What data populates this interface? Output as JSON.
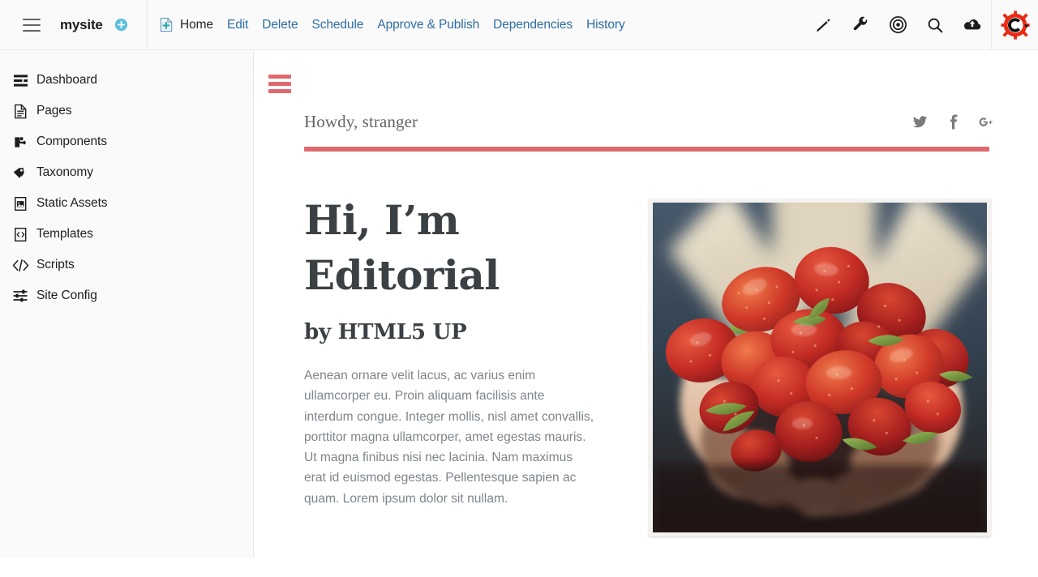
{
  "topbar": {
    "menu_icon": "hamburger-icon",
    "site_name": "mysite",
    "add_site_icon": "circle-plus-icon",
    "page_icon": "page-add-icon",
    "nav_items": [
      {
        "label": "Home",
        "active": true
      },
      {
        "label": "Edit",
        "active": false
      },
      {
        "label": "Delete",
        "active": false
      },
      {
        "label": "Schedule",
        "active": false
      },
      {
        "label": "Approve & Publish",
        "active": false
      },
      {
        "label": "Dependencies",
        "active": false
      },
      {
        "label": "History",
        "active": false
      }
    ],
    "tools": [
      {
        "name": "pencil-icon",
        "title": "Edit"
      },
      {
        "name": "wrench-icon",
        "title": "Tools"
      },
      {
        "name": "target-icon",
        "title": "Preview"
      },
      {
        "name": "search-icon",
        "title": "Search"
      },
      {
        "name": "cloud-upload-icon",
        "title": "Publish"
      }
    ],
    "logo": {
      "name": "crafter-gear-logo",
      "letter": "C"
    }
  },
  "sidebar": {
    "items": [
      {
        "label": "Dashboard",
        "icon": "dashboard-icon"
      },
      {
        "label": "Pages",
        "icon": "page-icon"
      },
      {
        "label": "Components",
        "icon": "components-icon"
      },
      {
        "label": "Taxonomy",
        "icon": "tag-icon"
      },
      {
        "label": "Static Assets",
        "icon": "image-icon"
      },
      {
        "label": "Templates",
        "icon": "template-code-icon"
      },
      {
        "label": "Scripts",
        "icon": "code-brackets-icon"
      },
      {
        "label": "Site Config",
        "icon": "sliders-icon"
      }
    ]
  },
  "preview": {
    "menu_icon": "hamburger-icon",
    "greeting": "Howdy, stranger",
    "social": [
      {
        "name": "twitter-icon",
        "label": "Twitter"
      },
      {
        "name": "facebook-icon",
        "label": "Facebook"
      },
      {
        "name": "google-plus-icon",
        "label": "Google+"
      }
    ],
    "title_line1": "Hi, I’m",
    "title_line2": "Editorial",
    "subtitle": "by HTML5 UP",
    "paragraph": "Aenean ornare velit lacus, ac varius enim ullamcorper eu. Proin aliquam facilisis ante interdum congue. Integer mollis, nisl amet convallis, porttitor magna ullamcorper, amet egestas mauris. Ut magna finibus nisi nec lacinia. Nam maximus erat id euismod egestas. Pellentesque sapien ac quam. Lorem ipsum dolor sit nullam.",
    "photo": {
      "name": "strawberries-in-hands-photo",
      "alt": "Hands holding strawberries"
    }
  },
  "colors": {
    "accent_red": "#e0696e",
    "link_blue": "#2e6da4",
    "logo_red": "#ea2a14",
    "text_dark": "#3b4044",
    "text_muted": "#7e858b"
  }
}
